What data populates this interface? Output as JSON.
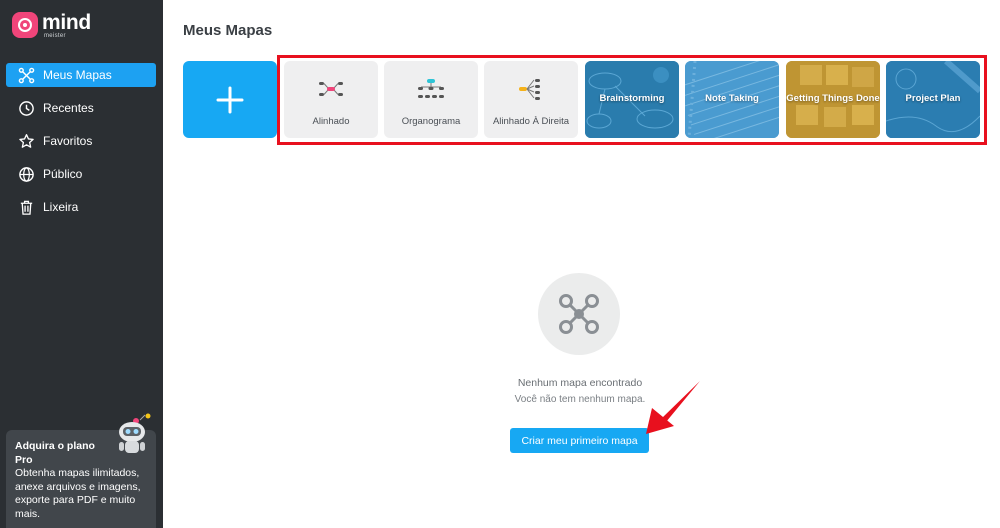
{
  "logo": {
    "main": "mind",
    "sub": "meister"
  },
  "sidebar": {
    "items": [
      {
        "label": "Meus Mapas",
        "icon": "mindmap-icon",
        "active": true
      },
      {
        "label": "Recentes",
        "icon": "clock-icon"
      },
      {
        "label": "Favoritos",
        "icon": "star-icon"
      },
      {
        "label": "Público",
        "icon": "globe-icon"
      },
      {
        "label": "Lixeira",
        "icon": "trash-icon"
      }
    ]
  },
  "promo": {
    "title": "Adquira o plano Pro",
    "text": "Obtenha mapas ilimitados, anexe arquivos e imagens, exporte para PDF e muito mais."
  },
  "main": {
    "title": "Meus Mapas"
  },
  "templates": [
    {
      "label": "Alinhado",
      "kind": "icon"
    },
    {
      "label": "Organograma",
      "kind": "icon"
    },
    {
      "label": "Alinhado À Direita",
      "kind": "icon"
    },
    {
      "label": "Brainstorming",
      "kind": "photo",
      "color": "#2b7fb0"
    },
    {
      "label": "Note Taking",
      "kind": "photo",
      "color": "#4a9cd0"
    },
    {
      "label": "Getting Things Done",
      "kind": "photo",
      "color": "#c49a34"
    },
    {
      "label": "Project Plan",
      "kind": "photo",
      "color": "#2c7fb3"
    }
  ],
  "empty": {
    "title": "Nenhum mapa encontrado",
    "subtitle": "Você não tem nenhum mapa.",
    "button": "Criar meu primeiro mapa"
  },
  "colors": {
    "accent": "#17a8f3",
    "sidebar": "#2b2f33",
    "highlight": "#e8101e",
    "brand": "#f0457a"
  }
}
